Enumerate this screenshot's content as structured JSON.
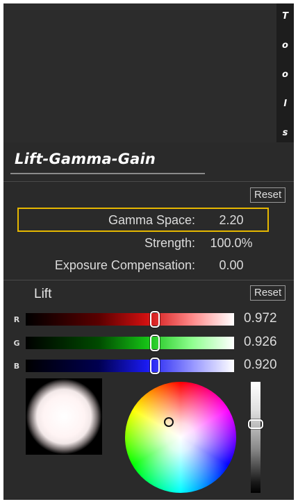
{
  "tools_tab": {
    "letters": [
      "T",
      "o",
      "o",
      "l",
      "s"
    ]
  },
  "panel": {
    "title": "Lift-Gamma-Gain",
    "reset_label": "Reset"
  },
  "params": {
    "gamma_space": {
      "label": "Gamma Space:",
      "value": "2.20"
    },
    "strength": {
      "label": "Strength:",
      "value": "100.0%"
    },
    "exposure": {
      "label": "Exposure Compensation:",
      "value": "0.00"
    }
  },
  "lift": {
    "label": "Lift",
    "reset_label": "Reset",
    "channels": [
      {
        "letter": "R",
        "value": "0.972",
        "position": 0.62
      },
      {
        "letter": "G",
        "value": "0.926",
        "position": 0.62
      },
      {
        "letter": "B",
        "value": "0.920",
        "position": 0.62
      }
    ],
    "brightness_level": 0.62
  },
  "colors": {
    "panel_bg": "#2a2a2a",
    "highlight": "#e6b800",
    "text": "#dcdcdc"
  }
}
